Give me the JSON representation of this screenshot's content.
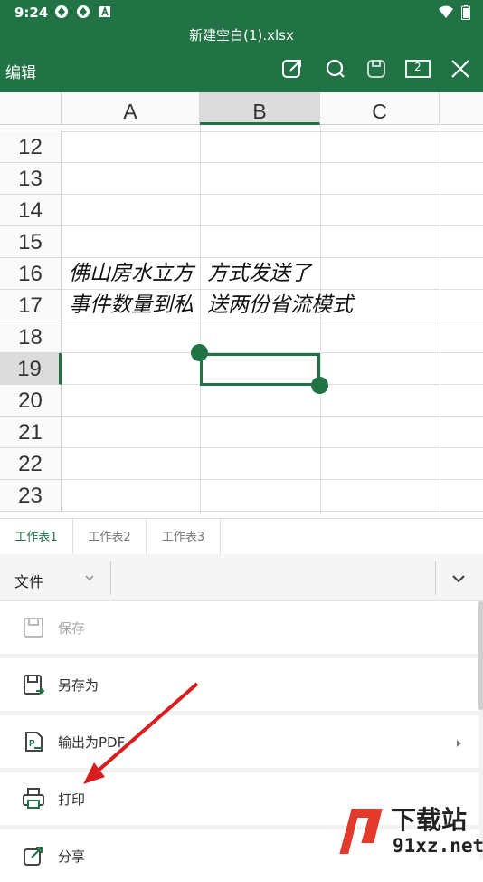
{
  "status_bar": {
    "time": "9:24"
  },
  "title_bar": {
    "file_name": "新建空白(1).xlsx"
  },
  "toolbar": {
    "edit_label": "编辑",
    "tab_count": "2"
  },
  "grid": {
    "columns": [
      "A",
      "B",
      "C"
    ],
    "selected_column": "B",
    "rows": [
      "12",
      "13",
      "14",
      "15",
      "16",
      "17",
      "18",
      "19",
      "20",
      "21",
      "22",
      "23"
    ],
    "selected_row": "19",
    "cells": {
      "A16": "佛山房水立方",
      "B16": "方式发送了",
      "A17": "事件数量到私",
      "B17": "送两份省流模式"
    }
  },
  "sheet_tabs": [
    "工作表1",
    "工作表2",
    "工作表3"
  ],
  "active_sheet": "工作表1",
  "menu": {
    "category": "文件",
    "items": [
      {
        "label": "保存",
        "icon": "save-icon",
        "disabled": true
      },
      {
        "label": "另存为",
        "icon": "save-as-icon",
        "disabled": false
      },
      {
        "label": "输出为PDF",
        "icon": "pdf-icon",
        "disabled": false,
        "has_submenu": true
      },
      {
        "label": "打印",
        "icon": "printer-icon",
        "disabled": false
      },
      {
        "label": "分享",
        "icon": "share-icon",
        "disabled": false
      }
    ]
  },
  "watermark": {
    "brand": "下载站",
    "site": "91xz.net"
  },
  "colors": {
    "accent": "#217346",
    "annotation_arrow": "#d81e1e"
  }
}
